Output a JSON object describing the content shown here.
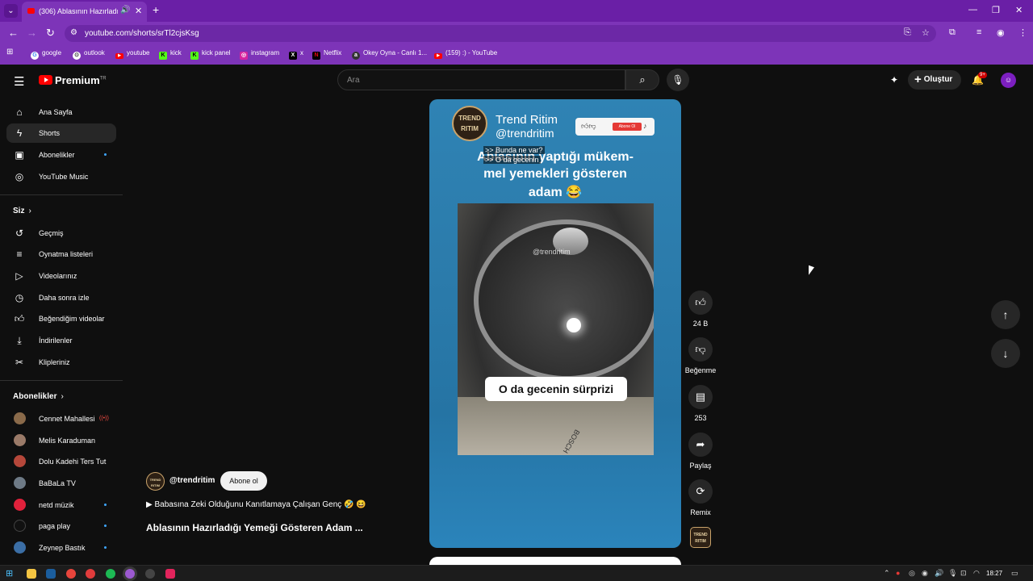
{
  "browser": {
    "tab_title": "(306) Ablasının Hazırladığı Y",
    "url": "youtube.com/shorts/srTl2cjsKsg",
    "bookmarks": [
      "google",
      "outlook",
      "youtube",
      "kick",
      "kick panel",
      "instagram",
      "x",
      "Netflix",
      "Okey Oyna - Canlı 1...",
      "(159) :) - YouTube"
    ]
  },
  "header": {
    "logo": "Premium",
    "logo_region": "TR",
    "search_placeholder": "Ara",
    "create_label": "Oluştur",
    "notif_count": "9+"
  },
  "sidebar": {
    "main": [
      {
        "label": "Ana Sayfa",
        "icon": "home-icon"
      },
      {
        "label": "Shorts",
        "icon": "shorts-icon",
        "active": true
      },
      {
        "label": "Abonelikler",
        "icon": "subscriptions-icon",
        "dot": true
      },
      {
        "label": "YouTube Music",
        "icon": "music-icon"
      }
    ],
    "you_header": "Siz",
    "you": [
      {
        "label": "Geçmiş",
        "icon": "history-icon"
      },
      {
        "label": "Oynatma listeleri",
        "icon": "playlist-icon"
      },
      {
        "label": "Videolarınız",
        "icon": "your-videos-icon"
      },
      {
        "label": "Daha sonra izle",
        "icon": "watch-later-icon"
      },
      {
        "label": "Beğendiğim videolar",
        "icon": "liked-icon"
      },
      {
        "label": "İndirilenler",
        "icon": "download-icon"
      },
      {
        "label": "Klipleriniz",
        "icon": "clips-icon"
      }
    ],
    "subs_header": "Abonelikler",
    "subs": [
      {
        "label": "Cennet Mahallesi",
        "color": "#8a6a4a",
        "status": "live"
      },
      {
        "label": "Melis Karaduman",
        "color": "#9a7a68",
        "status": ""
      },
      {
        "label": "Dolu Kadehi Ters Tut",
        "color": "#b5473a",
        "status": ""
      },
      {
        "label": "BaBaLa TV",
        "color": "#6e7a86",
        "status": ""
      },
      {
        "label": "netd müzik",
        "color": "#e0213b",
        "status": "dot"
      },
      {
        "label": "paga play",
        "color": "#111111",
        "status": "dot"
      },
      {
        "label": "Zeynep Bastık",
        "color": "#3b6ea5",
        "status": "dot"
      }
    ]
  },
  "short": {
    "channel_name": "Trend Ritim",
    "channel_handle": "@trendritim",
    "badge_line1": "TREND",
    "badge_line2": "RITIM",
    "subscribe_widget": "Abone Ol",
    "overlay1": ">> Bunda ne var?",
    "overlay2": ">> O da gecenin",
    "caption1": "Ablasının yaptığı mükem-",
    "caption2": "mel yemekleri gösteren",
    "caption3": "adam 😂",
    "watermark": "@trendritim",
    "subtitle": "O da gecenin sürprizi",
    "stove_brand": "BOSCH"
  },
  "actions": {
    "like": "24 B",
    "dislike": "Beğenme",
    "comments": "253",
    "share": "Paylaş",
    "remix": "Remix"
  },
  "info": {
    "handle": "@trendritim",
    "subscribe": "Abone ol",
    "linked_video": "▶ Babasına Zeki Olduğunu Kanıtlamaya Çalışan Genç 🤣 😆",
    "title": "Ablasının Hazırladığı Yemeği Gösteren Adam ..."
  },
  "taskbar": {
    "time": "18:27"
  }
}
